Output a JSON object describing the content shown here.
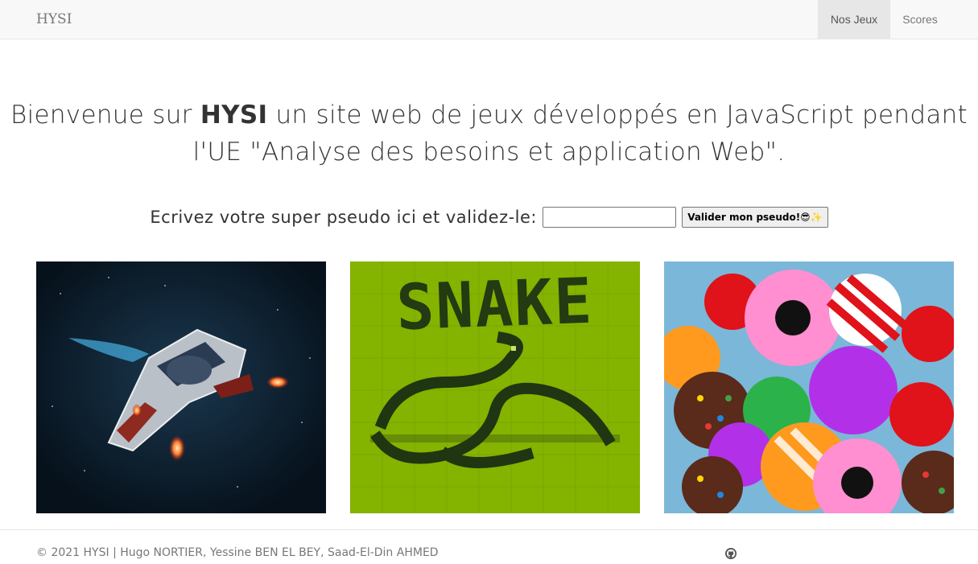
{
  "navbar": {
    "brand": "HYSI",
    "links": [
      {
        "label": "Nos Jeux",
        "active": true
      },
      {
        "label": "Scores",
        "active": false
      }
    ]
  },
  "intro": {
    "before": "Bienvenue sur ",
    "brand": "HYSI",
    "after": " un site web de jeux développés en JavaScript pendant l'UE \"Analyse des besoins et application Web\"."
  },
  "pseudo": {
    "label": "Ecrivez votre super pseudo ici et validez-le:",
    "value": "",
    "button_label": "Valider mon pseudo!😎✨"
  },
  "games": [
    {
      "name": "space-shooter",
      "logo_text": ""
    },
    {
      "name": "snake",
      "logo_text": "SNAKE"
    },
    {
      "name": "candy",
      "logo_text": ""
    }
  ],
  "footer": {
    "copyright": "© 2021 HYSI | Hugo NORTIER, Yessine BEN EL BEY, Saad-El-Din AHMED",
    "github_icon": "github-icon"
  },
  "colors": {
    "navbar_bg": "#f8f8f8",
    "nav_active_bg": "#e7e7e7",
    "snake_green": "#7fb800",
    "space_bg": "#0b1c2b"
  }
}
